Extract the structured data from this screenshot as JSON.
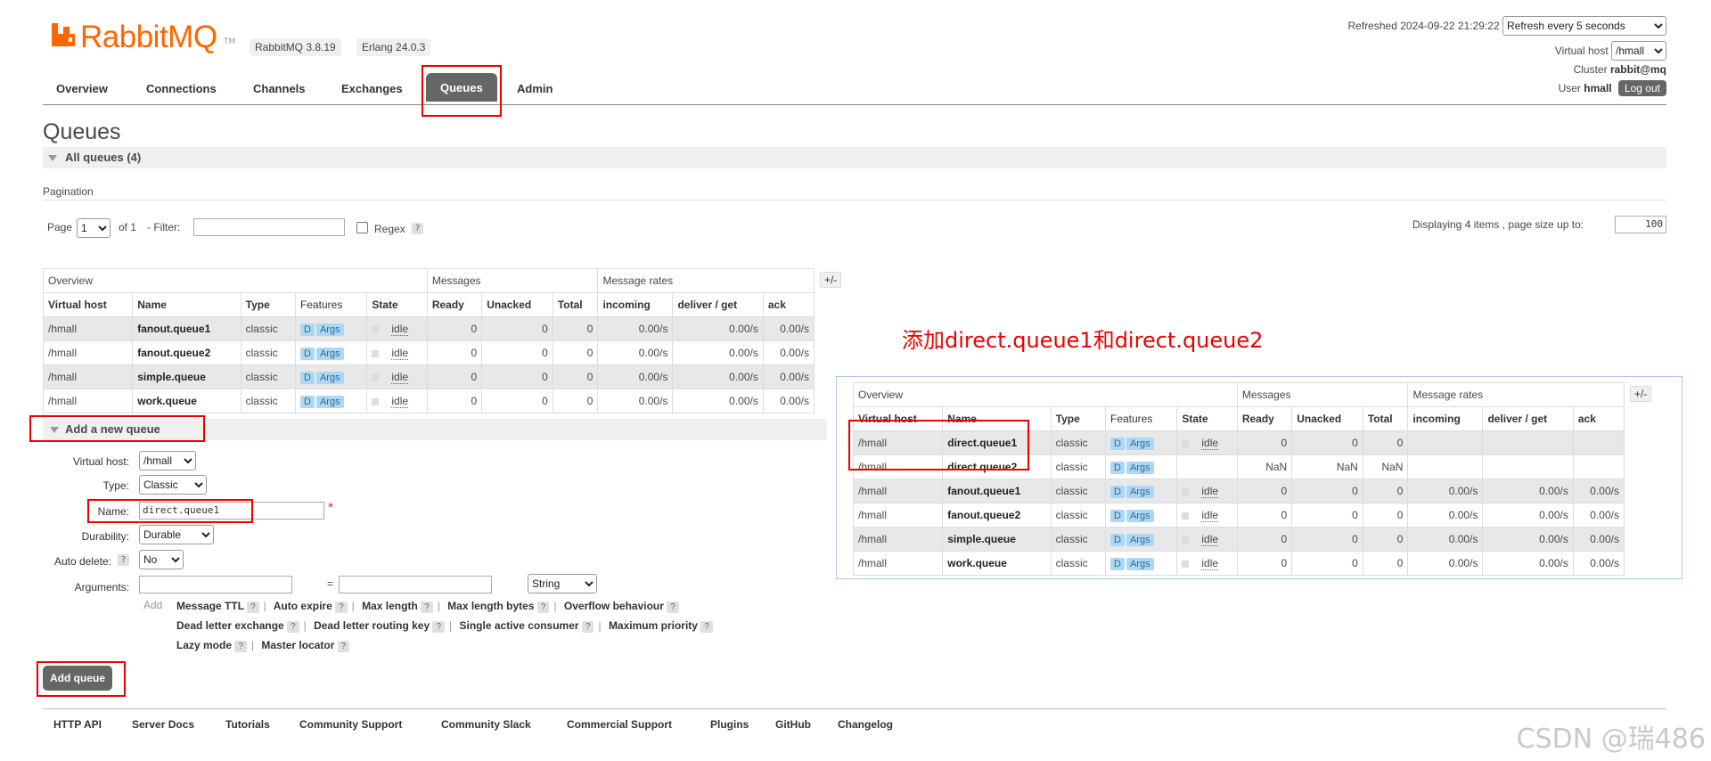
{
  "header": {
    "logo_text": "RabbitMQ",
    "logo_tm": "TM",
    "version_badge": "RabbitMQ 3.8.19",
    "erlang_badge": "Erlang 24.0.3",
    "refreshed_label": "Refreshed 2024-09-22 21:29:22",
    "refresh_select": "Refresh every 5 seconds",
    "virtual_host_label": "Virtual host",
    "virtual_host_value": "/hmall",
    "cluster_label": "Cluster",
    "cluster_value": "rabbit@mq",
    "user_label": "User",
    "user_value": "hmall",
    "logout_label": "Log out"
  },
  "tabs": [
    "Overview",
    "Connections",
    "Channels",
    "Exchanges",
    "Queues",
    "Admin"
  ],
  "page": {
    "title": "Queues",
    "all_queues": "All queues (4)",
    "pagination_label": "Pagination",
    "page_label": "Page",
    "page_value": "1",
    "of_label": "of 1",
    "filter_label": "- Filter:",
    "regex_label": "Regex",
    "help": "?",
    "displaying": "Displaying 4 items , page size up to:",
    "page_size": "100"
  },
  "table": {
    "groups": [
      "Overview",
      "Messages",
      "Message rates"
    ],
    "plusminus": "+/-",
    "columns": [
      "Virtual host",
      "Name",
      "Type",
      "Features",
      "State",
      "Ready",
      "Unacked",
      "Total",
      "incoming",
      "deliver / get",
      "ack"
    ],
    "rows": [
      {
        "vhost": "/hmall",
        "name": "fanout.queue1",
        "type": "classic",
        "f1": "D",
        "f2": "Args",
        "state": "idle",
        "ready": "0",
        "unacked": "0",
        "total": "0",
        "incoming": "0.00/s",
        "deliver": "0.00/s",
        "ack": "0.00/s"
      },
      {
        "vhost": "/hmall",
        "name": "fanout.queue2",
        "type": "classic",
        "f1": "D",
        "f2": "Args",
        "state": "idle",
        "ready": "0",
        "unacked": "0",
        "total": "0",
        "incoming": "0.00/s",
        "deliver": "0.00/s",
        "ack": "0.00/s"
      },
      {
        "vhost": "/hmall",
        "name": "simple.queue",
        "type": "classic",
        "f1": "D",
        "f2": "Args",
        "state": "idle",
        "ready": "0",
        "unacked": "0",
        "total": "0",
        "incoming": "0.00/s",
        "deliver": "0.00/s",
        "ack": "0.00/s"
      },
      {
        "vhost": "/hmall",
        "name": "work.queue",
        "type": "classic",
        "f1": "D",
        "f2": "Args",
        "state": "idle",
        "ready": "0",
        "unacked": "0",
        "total": "0",
        "incoming": "0.00/s",
        "deliver": "0.00/s",
        "ack": "0.00/s"
      }
    ]
  },
  "add_queue": {
    "section_title": "Add a new queue",
    "virtual_host_label": "Virtual host:",
    "virtual_host_value": "/hmall",
    "type_label": "Type:",
    "type_value": "Classic",
    "name_label": "Name:",
    "name_value": "direct.queue1",
    "required_mark": "*",
    "durability_label": "Durability:",
    "durability_value": "Durable",
    "auto_delete_label": "Auto delete:",
    "auto_delete_value": "No",
    "arguments_label": "Arguments:",
    "equals": "=",
    "arg_type": "String",
    "add_label": "Add",
    "arg_line1": [
      "Message TTL",
      "Auto expire",
      "Max length",
      "Max length bytes",
      "Overflow behaviour"
    ],
    "arg_line2": [
      "Dead letter exchange",
      "Dead letter routing key",
      "Single active consumer",
      "Maximum priority"
    ],
    "arg_line3": [
      "Lazy mode",
      "Master locator"
    ],
    "submit_label": "Add queue"
  },
  "footer_links": [
    "HTTP API",
    "Server Docs",
    "Tutorials",
    "Community Support",
    "Community Slack",
    "Commercial Support",
    "Plugins",
    "GitHub",
    "Changelog"
  ],
  "annotation": "添加direct.queue1和direct.queue2",
  "result_table": {
    "rows": [
      {
        "vhost": "/hmall",
        "name": "direct.queue1",
        "type": "classic",
        "f1": "D",
        "f2": "Args",
        "state": "idle",
        "ready": "0",
        "unacked": "0",
        "total": "0",
        "incoming": "",
        "deliver": "",
        "ack": ""
      },
      {
        "vhost": "/hmall",
        "name": "direct.queue2",
        "type": "classic",
        "f1": "D",
        "f2": "Args",
        "state": "",
        "ready": "NaN",
        "unacked": "NaN",
        "total": "NaN",
        "incoming": "",
        "deliver": "",
        "ack": ""
      },
      {
        "vhost": "/hmall",
        "name": "fanout.queue1",
        "type": "classic",
        "f1": "D",
        "f2": "Args",
        "state": "idle",
        "ready": "0",
        "unacked": "0",
        "total": "0",
        "incoming": "0.00/s",
        "deliver": "0.00/s",
        "ack": "0.00/s"
      },
      {
        "vhost": "/hmall",
        "name": "fanout.queue2",
        "type": "classic",
        "f1": "D",
        "f2": "Args",
        "state": "idle",
        "ready": "0",
        "unacked": "0",
        "total": "0",
        "incoming": "0.00/s",
        "deliver": "0.00/s",
        "ack": "0.00/s"
      },
      {
        "vhost": "/hmall",
        "name": "simple.queue",
        "type": "classic",
        "f1": "D",
        "f2": "Args",
        "state": "idle",
        "ready": "0",
        "unacked": "0",
        "total": "0",
        "incoming": "0.00/s",
        "deliver": "0.00/s",
        "ack": "0.00/s"
      },
      {
        "vhost": "/hmall",
        "name": "work.queue",
        "type": "classic",
        "f1": "D",
        "f2": "Args",
        "state": "idle",
        "ready": "0",
        "unacked": "0",
        "total": "0",
        "incoming": "0.00/s",
        "deliver": "0.00/s",
        "ack": "0.00/s"
      }
    ]
  },
  "watermark": "CSDN @瑞486",
  "colors": {
    "brand": "#ff6600",
    "tab_active": "#666666",
    "annotation": "#ee0000",
    "feature_badge": "#aed7f3"
  }
}
